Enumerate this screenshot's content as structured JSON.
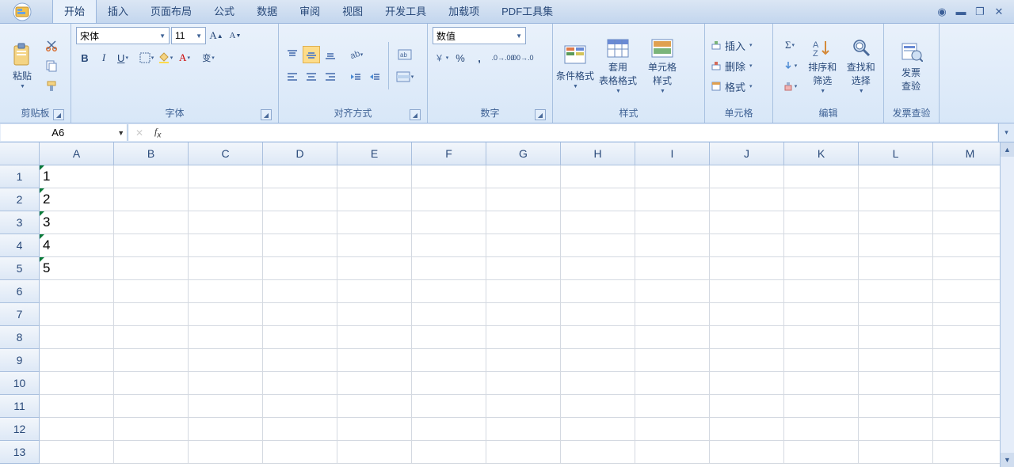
{
  "tabs": [
    "开始",
    "插入",
    "页面布局",
    "公式",
    "数据",
    "审阅",
    "视图",
    "开发工具",
    "加载项",
    "PDF工具集"
  ],
  "active_tab_index": 0,
  "ribbon": {
    "clipboard": {
      "title": "剪贴板",
      "paste": "粘贴"
    },
    "font": {
      "title": "字体",
      "name": "宋体",
      "size": "11"
    },
    "align": {
      "title": "对齐方式"
    },
    "number": {
      "title": "数字",
      "format": "数值"
    },
    "styles": {
      "title": "样式",
      "cond": "条件格式",
      "table": "套用\n表格格式",
      "cell": "单元格\n样式"
    },
    "cells": {
      "title": "单元格",
      "insert": "插入",
      "delete": "删除",
      "format": "格式"
    },
    "editing": {
      "title": "编辑",
      "sort": "排序和\n筛选",
      "find": "查找和\n选择"
    },
    "invoice": {
      "title": "发票查验",
      "btn": "发票\n查验"
    }
  },
  "namebox": "A6",
  "formula": "",
  "columns": [
    "A",
    "B",
    "C",
    "D",
    "E",
    "F",
    "G",
    "H",
    "I",
    "J",
    "K",
    "L",
    "M"
  ],
  "rows": 13,
  "cells": {
    "A1": "1",
    "A2": "2",
    "A3": "3",
    "A4": "4",
    "A5": "5"
  }
}
